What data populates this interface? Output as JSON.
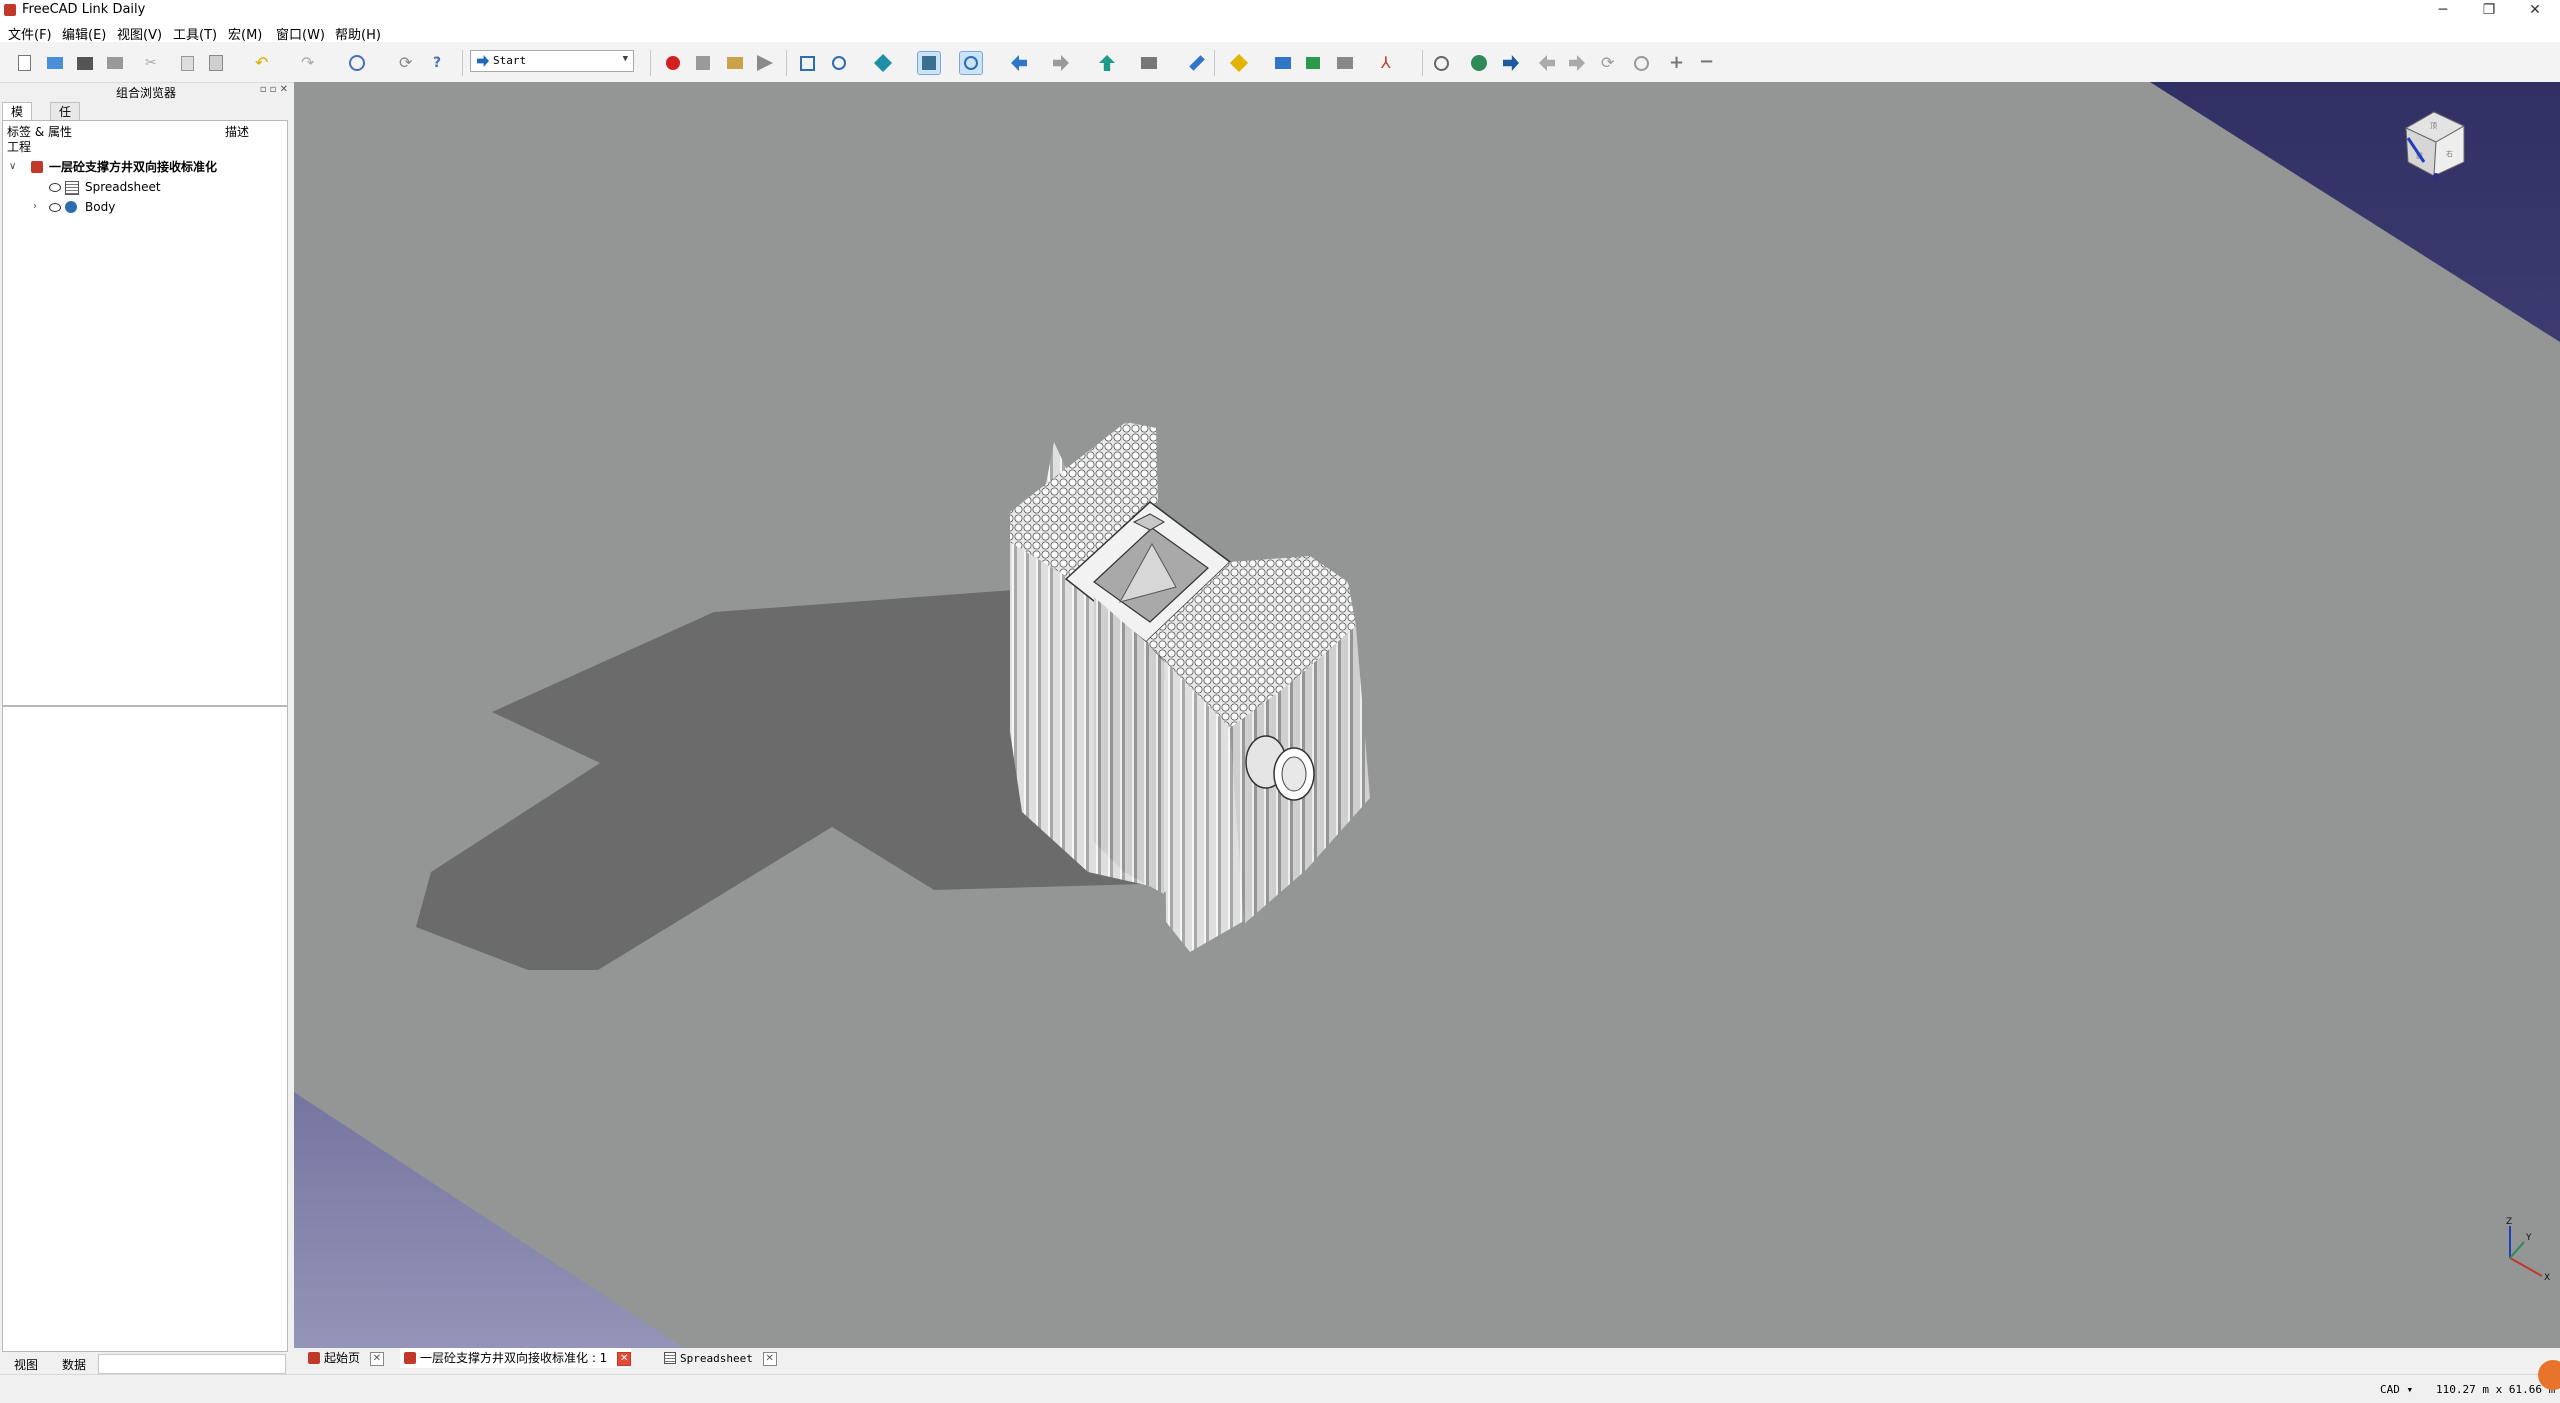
{
  "window": {
    "title": "FreeCAD Link Daily",
    "minimize": "─",
    "maximize": "❐",
    "close": "✕"
  },
  "menu": [
    "文件(F)",
    "编辑(E)",
    "视图(V)",
    "工具(T)",
    "宏(M)",
    "窗口(W)",
    "帮助(H)"
  ],
  "toolbar": {
    "workbench": "Start",
    "workbench_icon": "arrow-right-icon"
  },
  "combo_view": {
    "title": "组合浏览器",
    "dock_buttons": "▫ ▫ ✕",
    "tabs": [
      "模型",
      "任务"
    ],
    "tree_header": {
      "col1": "标签 & 属性",
      "col2": "描述"
    },
    "section": "工程",
    "document": "一层砼支撑方井双向接收标准化",
    "items": [
      {
        "label": "Spreadsheet",
        "icon": "spreadsheet-icon"
      },
      {
        "label": "Body",
        "icon": "body-icon"
      }
    ],
    "bottom_tabs": [
      "视图",
      "数据"
    ]
  },
  "doc_tabs": [
    {
      "label": "起始页",
      "icon": "freecad-icon"
    },
    {
      "label": "一层砼支撑方井双向接收标准化 : 1",
      "icon": "freecad-icon",
      "active": true
    },
    {
      "label": "Spreadsheet",
      "icon": "spreadsheet-icon"
    }
  ],
  "navcube": {
    "top": "顶",
    "front": "前",
    "right": "右"
  },
  "axis": {
    "x": "X",
    "y": "Y",
    "z": "Z"
  },
  "status": {
    "nav_style": "CAD ▾",
    "dimensions": "110.27 m x 61.66 m"
  },
  "colors": {
    "viewport_top": "#303065",
    "viewport_bottom": "#9494b8",
    "ground": "#949696",
    "shadow": "#6b6b6b"
  }
}
